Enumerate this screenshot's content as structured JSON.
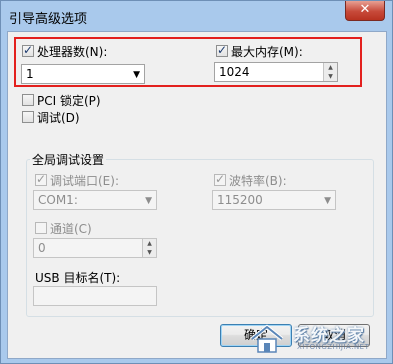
{
  "window": {
    "title": "引导高级选项",
    "close_glyph": "✕"
  },
  "processors": {
    "label": "处理器数(N):",
    "checked": true,
    "value": "1",
    "arrow": "▼"
  },
  "max_memory": {
    "label": "最大内存(M):",
    "checked": true,
    "value": "1024",
    "up": "▲",
    "down": "▼"
  },
  "pci_lock": {
    "label": "PCI 锁定(P)",
    "checked": false
  },
  "debug": {
    "label": "调试(D)",
    "checked": false
  },
  "global_debug": {
    "title": "全局调试设置",
    "debug_port": {
      "label": "调试端口(E):",
      "checked": true,
      "value": "COM1:",
      "arrow": "▼"
    },
    "baud_rate": {
      "label": "波特率(B):",
      "checked": true,
      "value": "115200",
      "arrow": "▼"
    },
    "channel": {
      "label": "通道(C)",
      "checked": false,
      "value": "0",
      "up": "▲",
      "down": "▼"
    },
    "usb_target": {
      "label": "USB 目标名(T):",
      "value": ""
    }
  },
  "buttons": {
    "ok_label": "确定",
    "cancel_label": "取消"
  },
  "watermark": {
    "text": "系统之家",
    "url": "XITONGZHIJIA.NET"
  },
  "colors": {
    "highlight_box": "#e3201e",
    "close_button": "#c74a3a"
  }
}
